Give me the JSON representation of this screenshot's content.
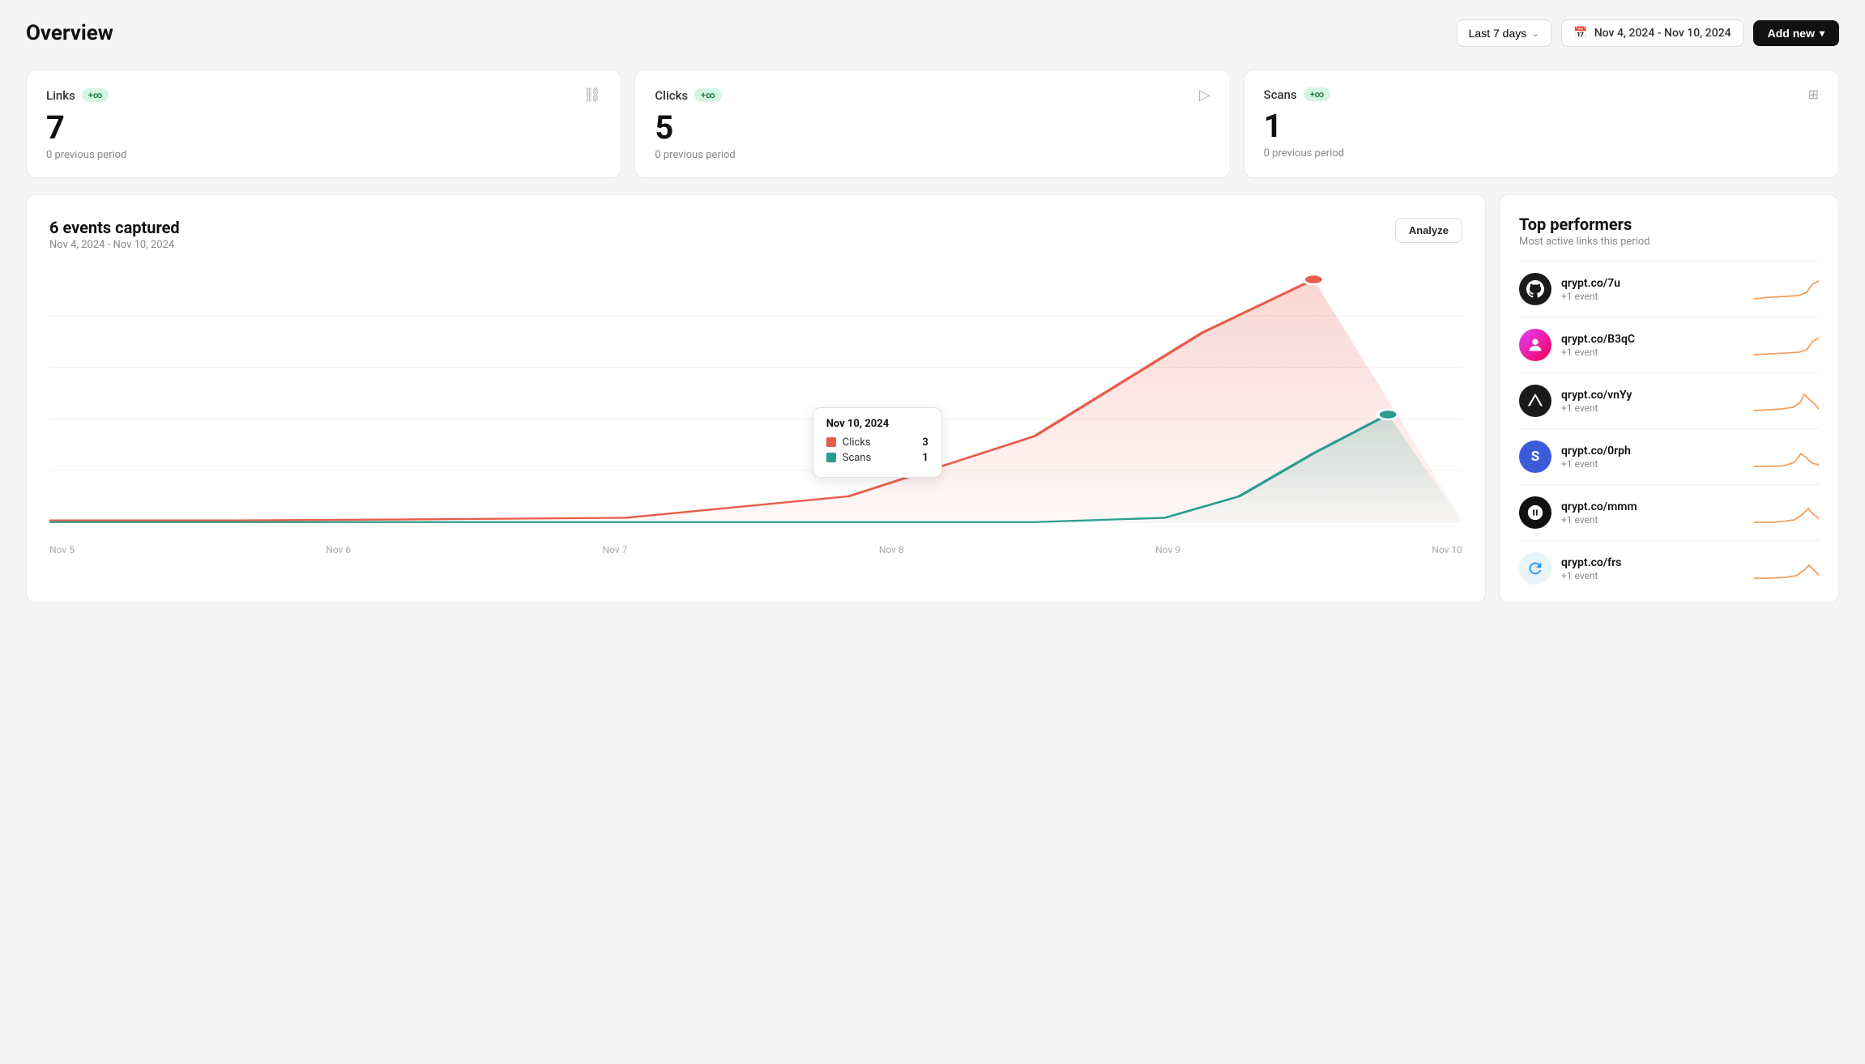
{
  "header": {
    "title": "Overview",
    "period_selector_label": "Last 7 days",
    "date_range": "Nov 4, 2024 - Nov 10, 2024",
    "add_new_label": "Add new"
  },
  "stats": [
    {
      "label": "Links",
      "badge": "+∞",
      "value": "7",
      "prev": "0 previous period",
      "icon": "link"
    },
    {
      "label": "Clicks",
      "badge": "+∞",
      "value": "5",
      "prev": "0 previous period",
      "icon": "cursor"
    },
    {
      "label": "Scans",
      "badge": "+∞",
      "value": "1",
      "prev": "0 previous period",
      "icon": "qr"
    }
  ],
  "chart": {
    "title": "6 events captured",
    "subtitle": "Nov 4, 2024 - Nov 10, 2024",
    "analyze_label": "Analyze",
    "x_labels": [
      "Nov 5",
      "Nov 6",
      "Nov 7",
      "Nov 8",
      "Nov 9",
      "Nov 10"
    ],
    "tooltip": {
      "date": "Nov 10, 2024",
      "clicks_label": "Clicks",
      "clicks_value": "3",
      "scans_label": "Scans",
      "scans_value": "1"
    }
  },
  "performers": {
    "title": "Top performers",
    "subtitle": "Most active links this period",
    "items": [
      {
        "url": "qrypt.co/7u",
        "event": "+1 event",
        "avatar_type": "github"
      },
      {
        "url": "qrypt.co/B3qC",
        "event": "+1 event",
        "avatar_type": "pink"
      },
      {
        "url": "qrypt.co/vnYy",
        "event": "+1 event",
        "avatar_type": "dark"
      },
      {
        "url": "qrypt.co/0rph",
        "event": "+1 event",
        "avatar_type": "blue"
      },
      {
        "url": "qrypt.co/mmm",
        "event": "+1 event",
        "avatar_type": "green"
      },
      {
        "url": "qrypt.co/frs",
        "event": "+1 event",
        "avatar_type": "teal"
      }
    ]
  }
}
